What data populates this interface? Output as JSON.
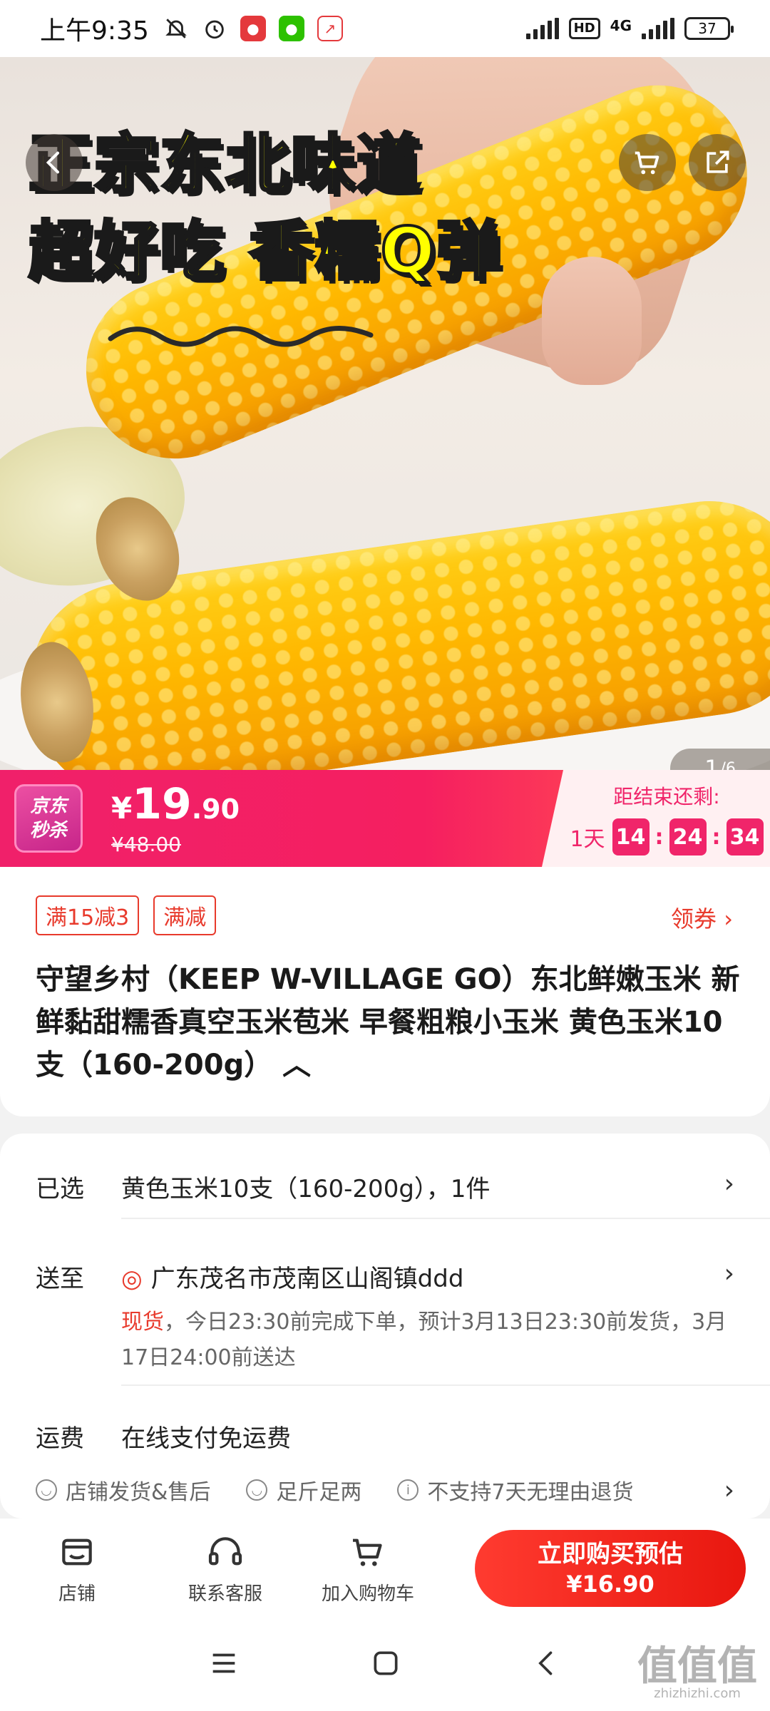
{
  "status_bar": {
    "time": "上午9:35",
    "network": "4G",
    "hd": "HD",
    "battery": "37"
  },
  "hero": {
    "title_line1": "正宗东北味道",
    "title_line2": "超好吃 香糯Q弹",
    "page_current": "1",
    "page_total": "/6"
  },
  "promo": {
    "badge_line1": "京东",
    "badge_line2": "秒杀",
    "currency": "¥",
    "price_int": "19",
    "price_dec": ".90",
    "price_original": "¥48.00",
    "countdown_label": "距结束还剩:",
    "countdown_days": "1天",
    "hours": "14",
    "minutes": "24",
    "seconds": "34",
    "accent_color": "#f0256a"
  },
  "product": {
    "tags": [
      "满15减3",
      "满减"
    ],
    "coupon_link": "领券 ›",
    "title": "守望乡村（KEEP W-VILLAGE GO）东北鲜嫩玉米 新鲜黏甜糯香真空玉米苞米 早餐粗粮小玉米 黄色玉米10支（160-200g） ︿"
  },
  "selection": {
    "selected_label": "已选",
    "selected_value": "黄色玉米10支（160-200g），1件",
    "delivery_label": "送至",
    "delivery_address": "广东茂名市茂南区山阁镇ddd",
    "ship_highlight": "现货",
    "ship_note": "，今日23:30前完成下单，预计3月13日23:30前发货，3月17日24:00前送达",
    "freight_label": "运费",
    "freight_value": "在线支付免运费"
  },
  "guarantees": [
    "店铺发货&售后",
    "足斤足两",
    "不支持7天无理由退货"
  ],
  "actions": {
    "store": "店铺",
    "service": "联系客服",
    "cart": "加入购物车",
    "buy_line1": "立即购买预估",
    "buy_line2": "¥16.90"
  },
  "watermark": {
    "main": "值值值",
    "sub": "zhizhizhi.com"
  }
}
